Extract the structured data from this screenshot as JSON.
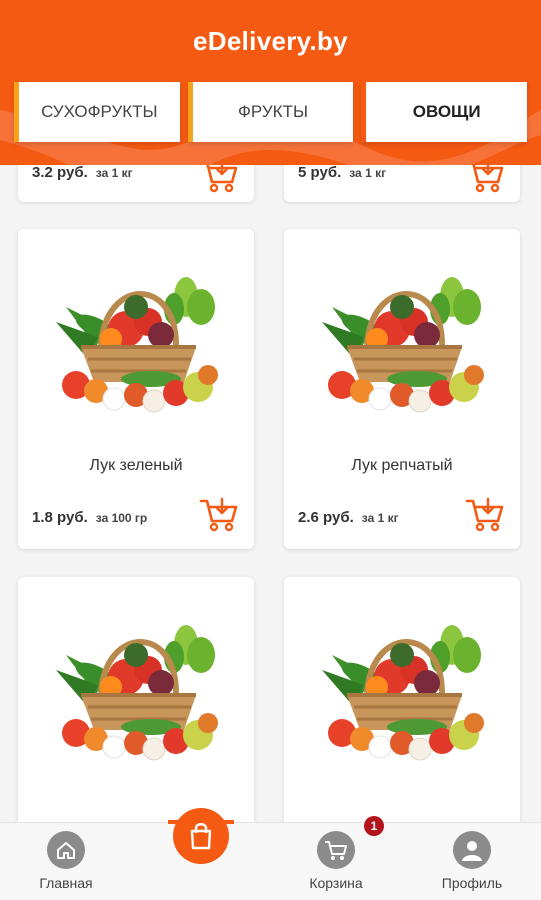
{
  "app": {
    "title": "eDelivery.by"
  },
  "tabs": [
    {
      "label": "СУХОФРУКТЫ"
    },
    {
      "label": "ФРУКТЫ"
    },
    {
      "label": "ОВОЩИ"
    }
  ],
  "partial_cards": [
    {
      "price": "3.2 руб.",
      "unit": "за 1 кг"
    },
    {
      "price": "5 руб.",
      "unit": "за 1 кг"
    }
  ],
  "cards": [
    {
      "name": "Лук зеленый",
      "price": "1.8 руб.",
      "unit": "за 100 гр",
      "image_icon": "vegetable-basket-icon"
    },
    {
      "name": "Лук репчатый",
      "price": "2.6 руб.",
      "unit": "за 1 кг",
      "image_icon": "vegetable-basket-icon"
    },
    {
      "name": "",
      "price": "",
      "unit": "",
      "image_icon": "vegetable-basket-icon"
    },
    {
      "name": "",
      "price": "",
      "unit": "",
      "image_icon": "vegetable-basket-icon"
    }
  ],
  "nav": {
    "home": {
      "label": "Главная",
      "icon": "home-icon"
    },
    "shop": {
      "icon": "shopping-bag-icon"
    },
    "cart": {
      "label": "Корзина",
      "icon": "cart-icon",
      "badge": "1"
    },
    "profile": {
      "label": "Профиль",
      "icon": "profile-icon"
    }
  },
  "colors": {
    "accent": "#f45a12",
    "tab_stripe": "#f6a21a",
    "badge": "#b3131b"
  }
}
